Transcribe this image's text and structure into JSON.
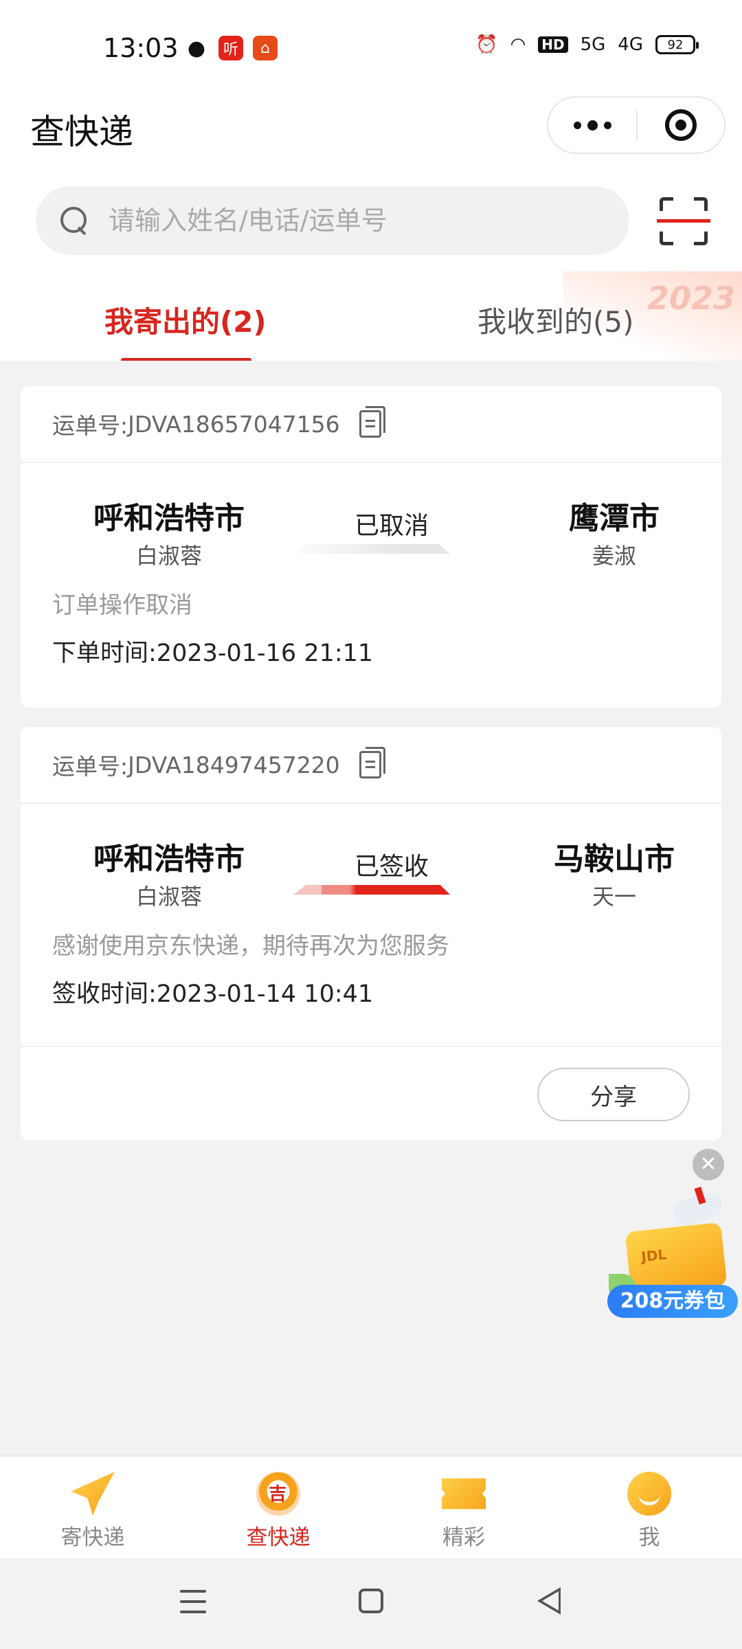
{
  "status_bar": {
    "time": "13:03",
    "battery": "92",
    "apps": [
      {
        "icon": "wechat-icon",
        "color": "#111111"
      },
      {
        "icon": "listen-app-icon",
        "glyph": "听",
        "color": "#e2231a"
      },
      {
        "icon": "home-app-icon",
        "glyph": "⌂",
        "color": "#e64a19"
      }
    ],
    "indicators": [
      "alarm-icon",
      "wifi-icon",
      "HD",
      "5G",
      "4G"
    ]
  },
  "header": {
    "title": "查快递"
  },
  "search": {
    "placeholder": "请输入姓名/电话/运单号"
  },
  "tabs": {
    "sent": "我寄出的(2)",
    "received": "我收到的(5)",
    "active": "sent",
    "decoration_year": "2023"
  },
  "shipments": [
    {
      "waybill_label": "运单号:",
      "waybill": "JDVA18657047156",
      "from_city": "呼和浩特市",
      "from_person": "白淑蓉",
      "status": "已取消",
      "to_city": "鹰潭市",
      "to_person": "姜淑",
      "note": "订单操作取消",
      "time_label": "下单时间:",
      "time": "2023-01-16 21:11"
    },
    {
      "waybill_label": "运单号:",
      "waybill": "JDVA18497457220",
      "from_city": "呼和浩特市",
      "from_person": "白淑蓉",
      "status": "已签收",
      "to_city": "马鞍山市",
      "to_person": "天一",
      "note": "感谢使用京东快递，期待再次为您服务",
      "time_label": "签收时间:",
      "time": "2023-01-14 10:41",
      "action": "分享"
    }
  ],
  "promo": {
    "label": "208元券包",
    "close": "✕"
  },
  "tabbar": [
    {
      "label": "寄快递",
      "icon": "send-plane-icon"
    },
    {
      "label": "查快递",
      "icon": "track-package-icon",
      "active": true
    },
    {
      "label": "精彩",
      "icon": "ticket-icon"
    },
    {
      "label": "我",
      "icon": "profile-icon"
    }
  ],
  "colors": {
    "accent": "#d6261e",
    "background": "#f2f2f2",
    "card": "#ffffff"
  }
}
